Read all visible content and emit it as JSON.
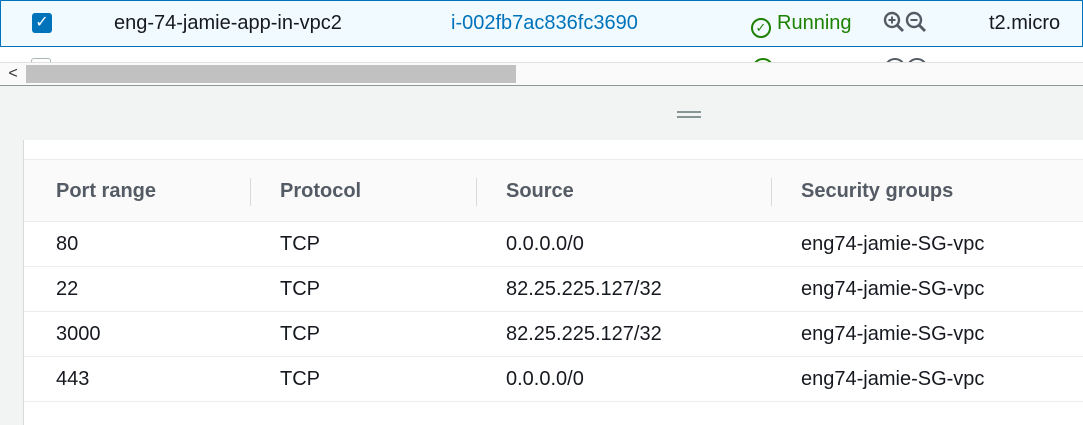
{
  "instance": {
    "checked_mark": "✓",
    "name": "eng-74-jamie-app-in-vpc2",
    "id": "i-002fb7ac836fc3690",
    "status": "Running",
    "status_icon": "check-circle-icon",
    "type": "t2.micro"
  },
  "scrollbar": {
    "left_arrow": "<"
  },
  "rules_table": {
    "headers": [
      "Port range",
      "Protocol",
      "Source",
      "Security groups"
    ],
    "rows": [
      [
        "80",
        "TCP",
        "0.0.0.0/0",
        "eng74-jamie-SG-vpc"
      ],
      [
        "22",
        "TCP",
        "82.25.225.127/32",
        "eng74-jamie-SG-vpc"
      ],
      [
        "3000",
        "TCP",
        "82.25.225.127/32",
        "eng74-jamie-SG-vpc"
      ],
      [
        "443",
        "TCP",
        "0.0.0.0/0",
        "eng74-jamie-SG-vpc"
      ]
    ]
  },
  "colors": {
    "link": "#0073bb",
    "running": "#1d8102",
    "header_text": "#545b64"
  }
}
